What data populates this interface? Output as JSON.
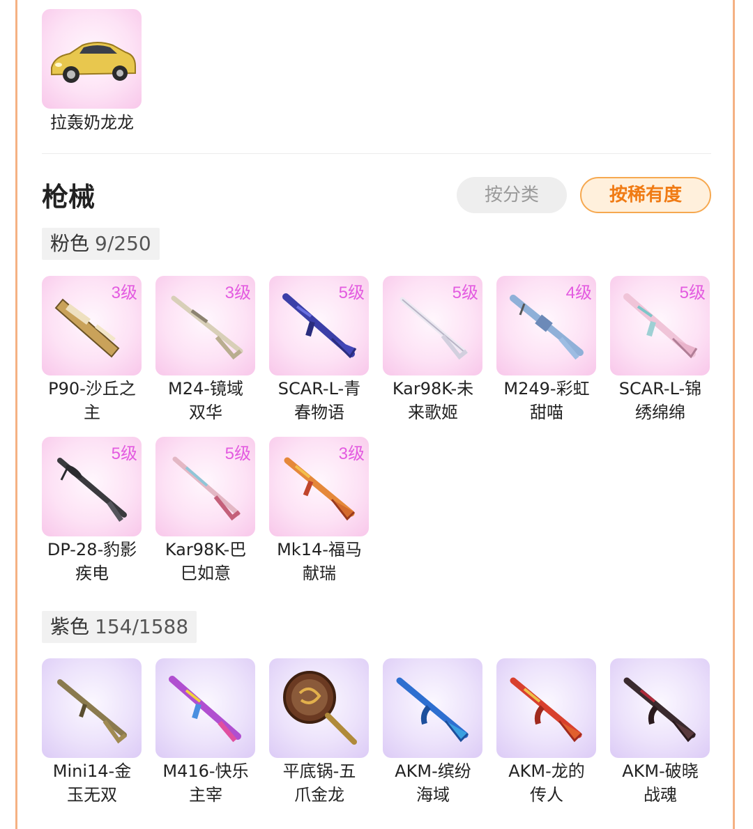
{
  "vehicle": {
    "name": "拉轰奶龙龙"
  },
  "section": {
    "title": "枪械",
    "buttons": {
      "by_category": "按分类",
      "by_rarity": "按稀有度"
    }
  },
  "groups": [
    {
      "label": "粉色",
      "count": "9/250",
      "color": "#fde2f5",
      "items": [
        {
          "name_line1": "P90-沙丘之",
          "name_line2": "主",
          "level": "3级"
        },
        {
          "name_line1": "M24-镜域",
          "name_line2": "双华",
          "level": "3级"
        },
        {
          "name_line1": "SCAR-L-青",
          "name_line2": "春物语",
          "level": "5级"
        },
        {
          "name_line1": "Kar98K-未",
          "name_line2": "来歌姬",
          "level": "5级"
        },
        {
          "name_line1": "M249-彩虹",
          "name_line2": "甜喵",
          "level": "4级"
        },
        {
          "name_line1": "SCAR-L-锦",
          "name_line2": "绣绵绵",
          "level": "5级"
        },
        {
          "name_line1": "DP-28-豹影",
          "name_line2": "疾电",
          "level": "5级"
        },
        {
          "name_line1": "Kar98K-巴",
          "name_line2": "巳如意",
          "level": "5级"
        },
        {
          "name_line1": "Mk14-福马",
          "name_line2": "献瑞",
          "level": "3级"
        }
      ]
    },
    {
      "label": "紫色",
      "count": "154/1588",
      "color": "#ece2fb",
      "items": [
        {
          "name_line1": "Mini14-金",
          "name_line2": "玉无双"
        },
        {
          "name_line1": "M416-快乐",
          "name_line2": "主宰"
        },
        {
          "name_line1": "平底锅-五",
          "name_line2": "爪金龙"
        },
        {
          "name_line1": "AKM-缤纷",
          "name_line2": "海域"
        },
        {
          "name_line1": "AKM-龙的",
          "name_line2": "传人"
        },
        {
          "name_line1": "AKM-破晓",
          "name_line2": "战魂"
        }
      ]
    }
  ]
}
